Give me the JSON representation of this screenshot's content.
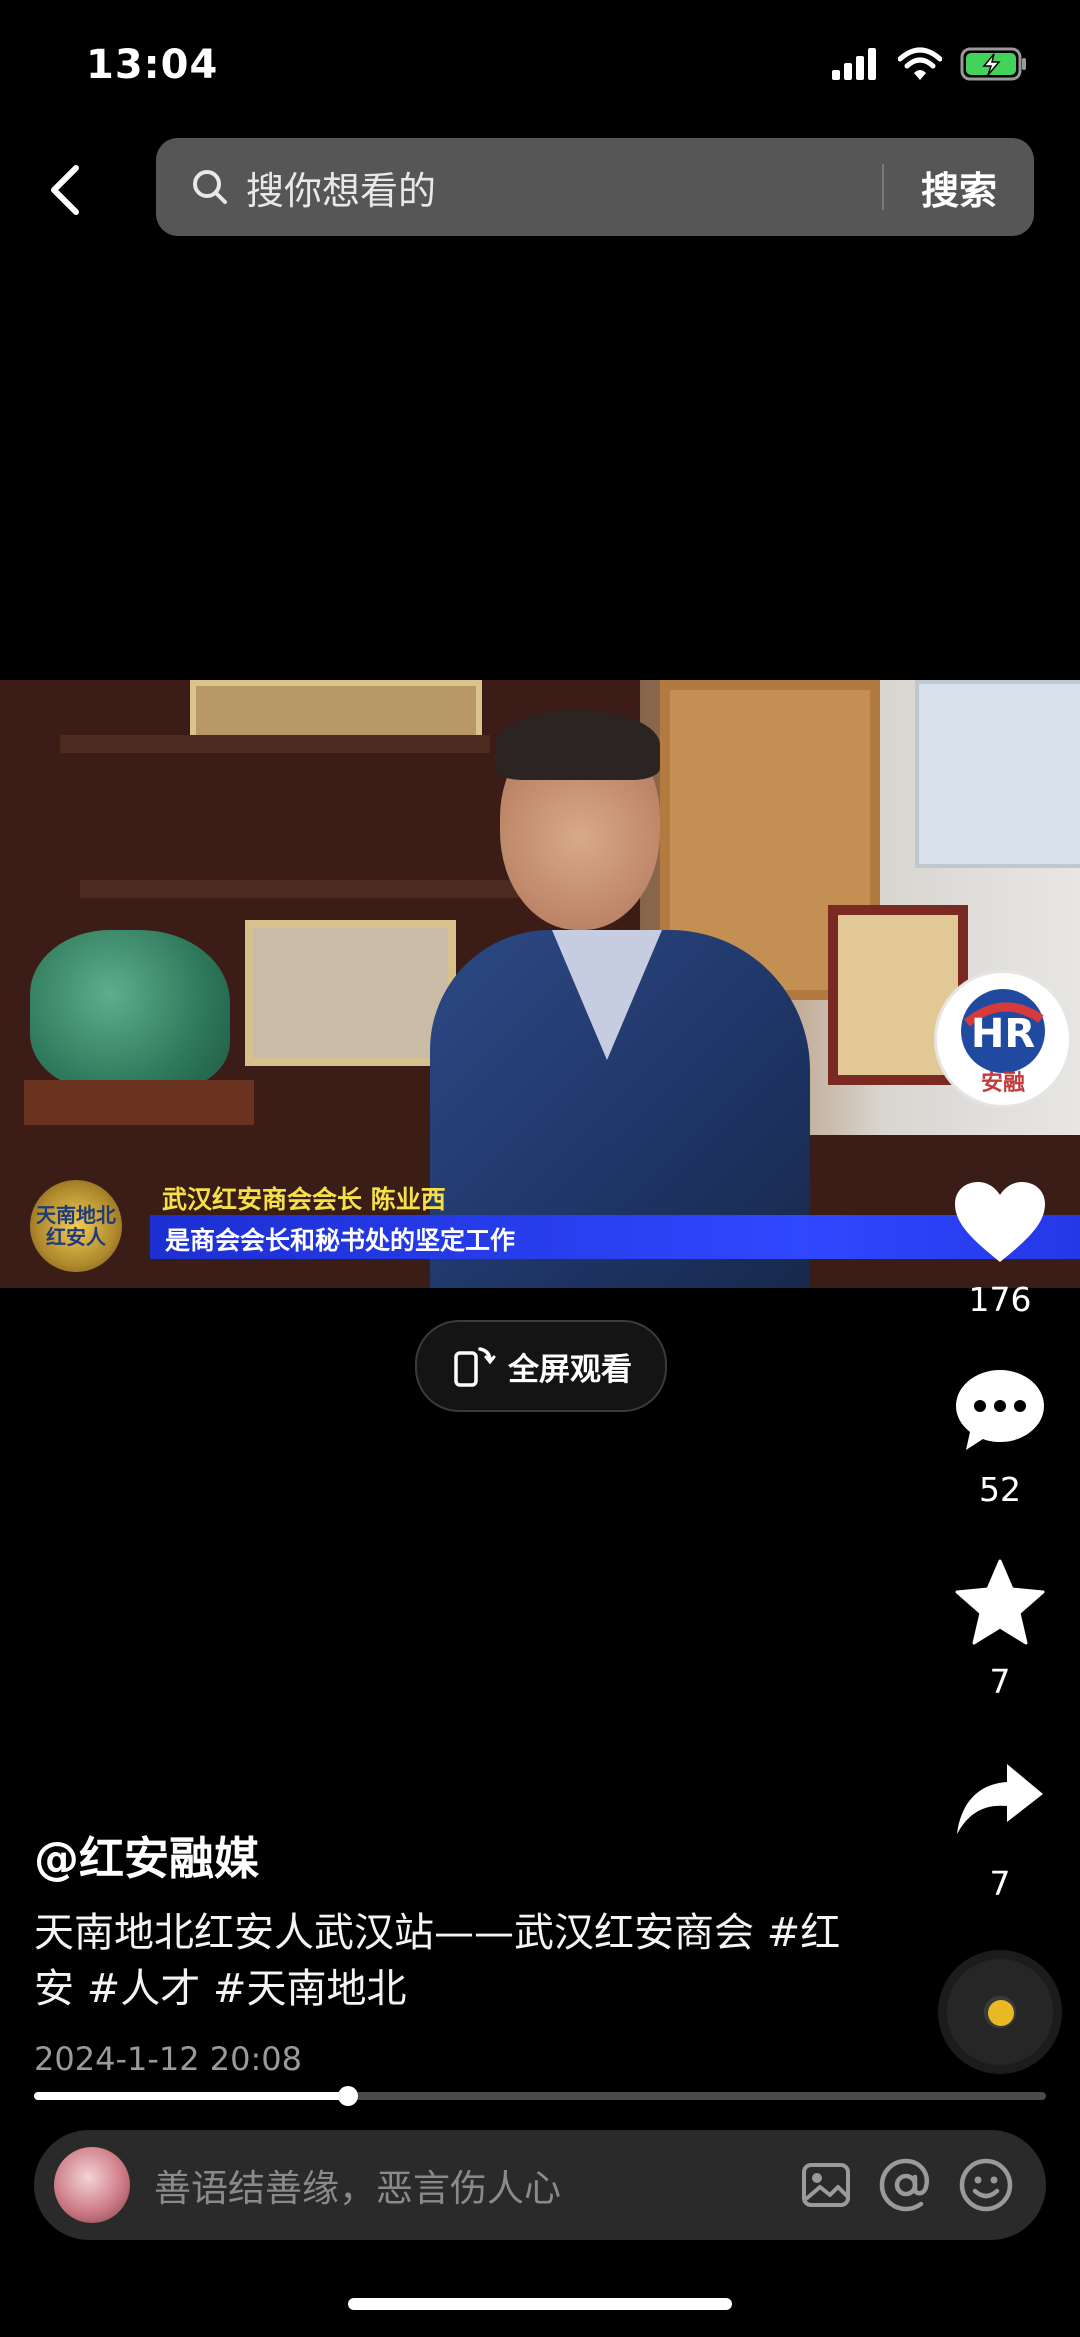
{
  "status_bar": {
    "time": "13:04"
  },
  "search": {
    "placeholder": "搜你想看的",
    "button_label": "搜索"
  },
  "video": {
    "lower_third_title": "武汉红安商会会长  陈业西",
    "lower_third_subtitle": "是商会会长和秘书处的坚定工作",
    "logo_text": "天南地北红安人"
  },
  "fullscreen": {
    "label": "全屏观看"
  },
  "rail": {
    "like_count": "176",
    "comment_count": "52",
    "favorite_count": "7",
    "share_count": "7",
    "avatar_text": "安融"
  },
  "post": {
    "author": "@红安融媒",
    "description": "天南地北红安人武汉站——武汉红安商会 #红安 #人才 #天南地北",
    "date": "2024-1-12 20:08"
  },
  "progress": {
    "fraction": 0.31
  },
  "comment_bar": {
    "placeholder": "善语结善缘，恶言伤人心"
  },
  "colors": {
    "accent_blue": "#2f48ff",
    "caption_yellow": "#f5e04a",
    "disc_yellow": "#e8b923"
  },
  "icons": [
    "back-arrow-icon",
    "search-icon",
    "signal-icon",
    "wifi-icon",
    "battery-charging-icon",
    "rotate-fullscreen-icon",
    "heart-icon",
    "comment-bubble-icon",
    "star-icon",
    "share-arrow-icon",
    "music-disc-icon",
    "image-icon",
    "at-icon",
    "emoji-icon"
  ]
}
